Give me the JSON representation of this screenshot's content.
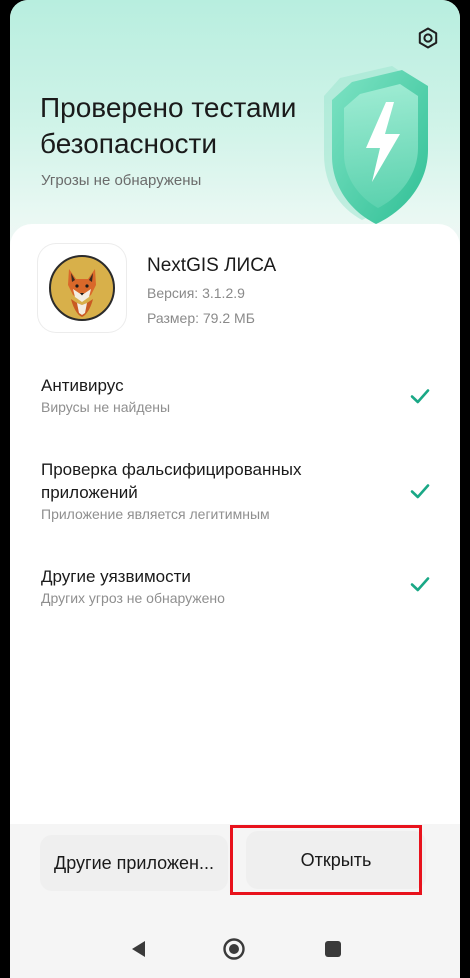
{
  "header": {
    "title": "Проверено тестами безопасности",
    "subtitle": "Угрозы не обнаружены",
    "settings_icon": "settings-icon",
    "shield_icon": "shield-lightning-icon"
  },
  "app": {
    "name": "NextGIS ЛИСА",
    "version": "Версия: 3.1.2.9",
    "size": "Размер: 79.2 МБ",
    "icon": "fox-logo"
  },
  "checks": [
    {
      "title": "Антивирус",
      "desc": "Вирусы не найдены",
      "status_icon": "check-icon"
    },
    {
      "title": "Проверка фальсифицированных приложений",
      "desc": "Приложение является легитимным",
      "status_icon": "check-icon"
    },
    {
      "title": "Другие уязвимости",
      "desc": "Других угроз не обнаружено",
      "status_icon": "check-icon"
    }
  ],
  "actions": {
    "other_apps": "Другие приложен...",
    "open": "Открыть"
  },
  "navbar": {
    "back_icon": "back-triangle-icon",
    "home_icon": "home-circle-icon",
    "recents_icon": "recents-square-icon"
  },
  "colors": {
    "accent": "#1aa886",
    "highlight": "#e8121c"
  }
}
